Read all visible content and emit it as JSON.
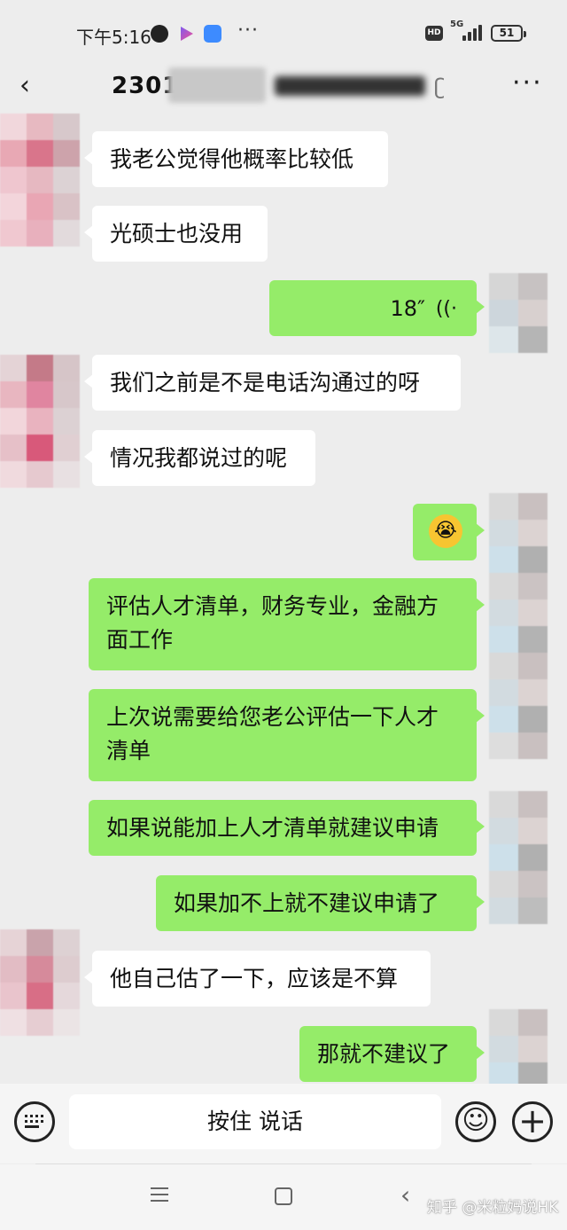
{
  "status_bar": {
    "time": "下午5:16",
    "more": "···",
    "hd_badge": "HD",
    "network": "5G",
    "battery": "51"
  },
  "header": {
    "title": "2301",
    "title_tail": "",
    "more": "···"
  },
  "messages": [
    {
      "side": "in",
      "text": "我老公觉得他概率比较低"
    },
    {
      "side": "in",
      "text": "光硕士也没用"
    },
    {
      "side": "out",
      "type": "voice",
      "duration": "18″"
    },
    {
      "side": "in",
      "text": "我们之前是不是电话沟通过的呀"
    },
    {
      "side": "in",
      "text": "情况我都说过的呢"
    },
    {
      "side": "out",
      "type": "emoji",
      "emoji": "😭"
    },
    {
      "side": "out",
      "text": "评估人才清单，财务专业，金融方面工作"
    },
    {
      "side": "out",
      "text": "上次说需要给您老公评估一下人才清单"
    },
    {
      "side": "out",
      "text": "如果说能加上人才清单就建议申请"
    },
    {
      "side": "out",
      "text": "如果加不上就不建议申请了"
    },
    {
      "side": "in",
      "text": "他自己估了一下，应该是不算"
    },
    {
      "side": "out",
      "text": "那就不建议了"
    }
  ],
  "input_bar": {
    "hold_to_talk": "按住 说话"
  },
  "watermark": "知乎 @米粒妈说HK",
  "colors": {
    "background": "#ededed",
    "outgoing_bubble": "#95ec69",
    "incoming_bubble": "#ffffff"
  }
}
